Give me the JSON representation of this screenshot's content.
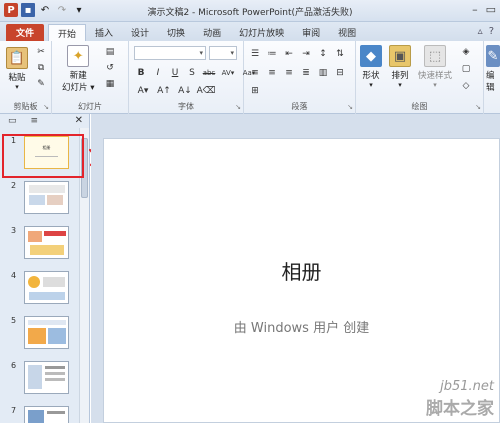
{
  "window": {
    "title": "演示文稿2 - Microsoft PowerPoint(产品激活失败)",
    "app_icon": "P"
  },
  "tabs": {
    "file": "文件",
    "items": [
      "开始",
      "插入",
      "设计",
      "切换",
      "动画",
      "幻灯片放映",
      "审阅",
      "视图"
    ],
    "active": "开始"
  },
  "ribbon": {
    "clipboard": {
      "label": "剪贴板",
      "paste": "粘贴"
    },
    "slides": {
      "label": "幻灯片",
      "new_slide": "新建",
      "new_slide_line2": "幻灯片 ▾"
    },
    "font": {
      "label": "字体",
      "row2": [
        "B",
        "I",
        "U",
        "S",
        "abc",
        "AV▾",
        "Aa▾"
      ],
      "row3": [
        "A▾",
        "A↑",
        "A↓"
      ]
    },
    "paragraph": {
      "label": "段落"
    },
    "drawing": {
      "label": "绘图",
      "shapes": "形状",
      "arrange": "排列",
      "quick_styles": "快速样式"
    },
    "editing": {
      "label": "编辑"
    }
  },
  "panel": {
    "tab_slides": "▭",
    "tab_outline": "≡",
    "close": "✕",
    "thumbs": [
      {
        "num": "1",
        "kind": "title",
        "text": "相册"
      },
      {
        "num": "2",
        "kind": "photo"
      },
      {
        "num": "3",
        "kind": "photo"
      },
      {
        "num": "4",
        "kind": "photo"
      },
      {
        "num": "5",
        "kind": "photo"
      },
      {
        "num": "6",
        "kind": "photo"
      },
      {
        "num": "7",
        "kind": "photo"
      }
    ]
  },
  "slide": {
    "title": "相册",
    "subtitle": "由 Windows 用户 创建"
  },
  "watermark": {
    "line1": "jb51.net",
    "line2": "脚本之家"
  },
  "colors": {
    "file_tab": "#c8442b",
    "annotation": "#e3242b",
    "selected_thumb_border": "#e9b645"
  }
}
